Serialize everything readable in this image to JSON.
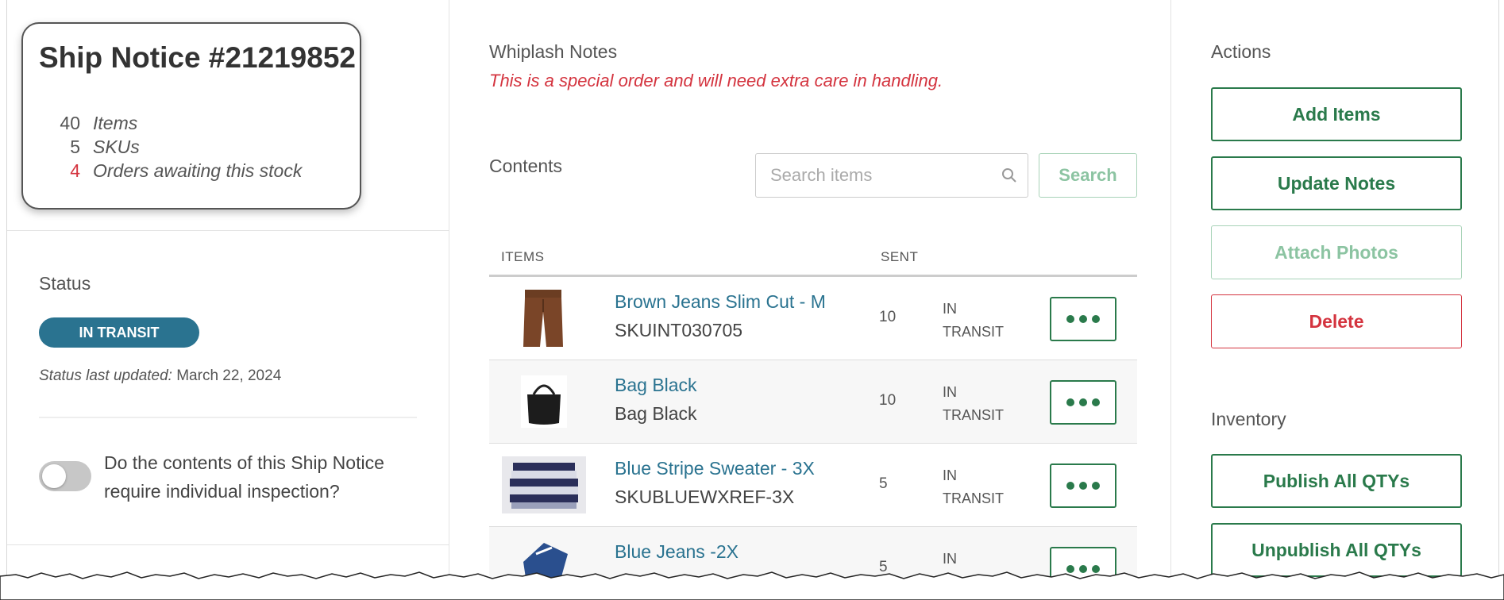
{
  "ship_notice": {
    "title": "Ship Notice #21219852",
    "stats": [
      {
        "num": "40",
        "label": "Items"
      },
      {
        "num": "5",
        "label": "SKUs"
      },
      {
        "num": "4",
        "label": "Orders awaiting this stock"
      }
    ]
  },
  "status": {
    "heading": "Status",
    "badge": "IN TRANSIT",
    "updated_label": "Status last updated:",
    "updated_value": "March 22, 2024",
    "inspection_question": "Do the contents of this Ship Notice require individual inspection?"
  },
  "notes": {
    "heading": "Whiplash Notes",
    "text": "This is a special order and will need extra care in handling."
  },
  "contents": {
    "heading": "Contents",
    "search_placeholder": "Search items",
    "search_button": "Search",
    "columns": {
      "items": "ITEMS",
      "sent": "SENT"
    },
    "rows": [
      {
        "name": "Brown Jeans Slim Cut - M",
        "sku": "SKUINT030705",
        "sent": "10",
        "status": "IN TRANSIT",
        "thumb": "brown-jeans"
      },
      {
        "name": "Bag Black",
        "sku": "Bag Black",
        "sent": "10",
        "status": "IN TRANSIT",
        "thumb": "black-bag"
      },
      {
        "name": "Blue Stripe Sweater - 3X",
        "sku": "SKUBLUEWXREF-3X",
        "sent": "5",
        "status": "IN TRANSIT",
        "thumb": "striped-sweater"
      },
      {
        "name": "Blue Jeans -2X",
        "sku": "",
        "sent": "5",
        "status": "IN",
        "thumb": "blue-jeans"
      }
    ]
  },
  "actions": {
    "heading": "Actions",
    "add_items": "Add Items",
    "update_notes": "Update Notes",
    "attach_photos": "Attach Photos",
    "delete": "Delete"
  },
  "inventory": {
    "heading": "Inventory",
    "publish": "Publish All QTYs",
    "unpublish": "Unpublish All QTYs"
  },
  "colors": {
    "accent_green": "#2a7a4b",
    "link_blue": "#2a7390",
    "danger_red": "#d4343f",
    "badge_blue": "#2a7390"
  }
}
